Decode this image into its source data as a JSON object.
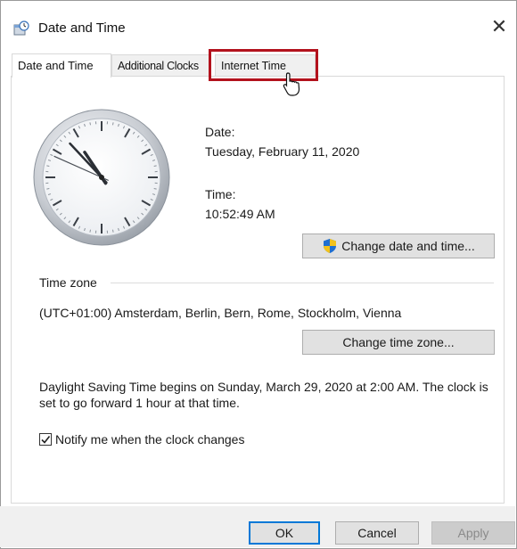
{
  "window": {
    "title": "Date and Time",
    "close_glyph": "✕",
    "icon": "date-time-control-panel-icon"
  },
  "tabs": [
    {
      "label": "Date and Time",
      "active": true
    },
    {
      "label": "Additional Clocks",
      "active": false
    },
    {
      "label": "Internet Time",
      "active": false,
      "highlighted": true
    }
  ],
  "date_section": {
    "date_label": "Date:",
    "date_value": "Tuesday, February 11, 2020",
    "time_label": "Time:",
    "time_value": "10:52:49 AM",
    "change_button": "Change date and time...",
    "change_button_icon": "uac-shield-icon"
  },
  "clock": {
    "hours": 10,
    "minutes": 52,
    "seconds": 49
  },
  "time_zone": {
    "group_label": "Time zone",
    "value": "(UTC+01:00) Amsterdam, Berlin, Bern, Rome, Stockholm, Vienna",
    "change_button": "Change time zone..."
  },
  "dst": {
    "message": "Daylight Saving Time begins on Sunday, March 29, 2020 at 2:00 AM. The clock is set to go forward 1 hour at that time.",
    "notify_label": "Notify me when the clock changes",
    "notify_checked": true
  },
  "footer": {
    "ok": "OK",
    "cancel": "Cancel",
    "apply": "Apply",
    "apply_enabled": false
  },
  "colors": {
    "highlight_border": "#b3121d",
    "default_button_border": "#0078d7",
    "shield_blue": "#1f6fd1",
    "shield_yellow": "#f3c21b"
  }
}
